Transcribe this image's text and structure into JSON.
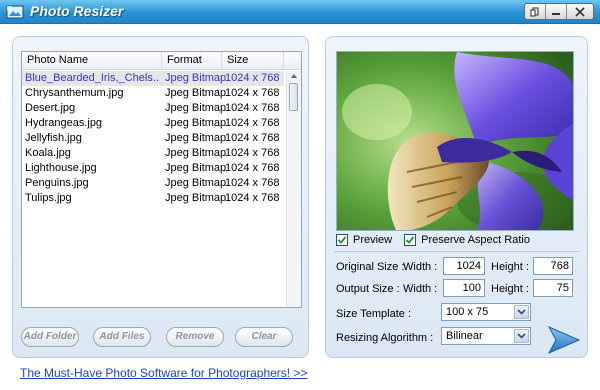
{
  "window": {
    "title": "Photo Resizer",
    "controls": [
      "restore",
      "minimize",
      "close"
    ]
  },
  "file_list": {
    "columns": [
      "Photo Name",
      "Format",
      "Size"
    ],
    "rows": [
      {
        "name": "Blue_Bearded_Iris,_Chels..",
        "format": "Jpeg Bitmap",
        "size": "1024 x 768",
        "selected": true
      },
      {
        "name": "Chrysanthemum.jpg",
        "format": "Jpeg Bitmap",
        "size": "1024 x 768"
      },
      {
        "name": "Desert.jpg",
        "format": "Jpeg Bitmap",
        "size": "1024 x 768"
      },
      {
        "name": "Hydrangeas.jpg",
        "format": "Jpeg Bitmap",
        "size": "1024 x 768"
      },
      {
        "name": "Jellyfish.jpg",
        "format": "Jpeg Bitmap",
        "size": "1024 x 768"
      },
      {
        "name": "Koala.jpg",
        "format": "Jpeg Bitmap",
        "size": "1024 x 768"
      },
      {
        "name": "Lighthouse.jpg",
        "format": "Jpeg Bitmap",
        "size": "1024 x 768"
      },
      {
        "name": "Penguins.jpg",
        "format": "Jpeg Bitmap",
        "size": "1024 x 768"
      },
      {
        "name": "Tulips.jpg",
        "format": "Jpeg Bitmap",
        "size": "1024 x 768"
      }
    ]
  },
  "buttons": {
    "add_folder": "Add Folder",
    "add_files": "Add Files",
    "remove": "Remove",
    "clear": "Clear"
  },
  "preview": {
    "preview_label": "Preview",
    "preview_checked": true,
    "aspect_label": "Preserve Aspect Ratio",
    "aspect_checked": true
  },
  "sizes": {
    "original_label": "Original Size :",
    "output_label": "Output Size :",
    "width_label": "Width :",
    "height_label": "Height :",
    "original_width": "1024",
    "original_height": "768",
    "output_width": "100",
    "output_height": "75"
  },
  "template": {
    "label": "Size Template :",
    "value": "100 x 75"
  },
  "algorithm": {
    "label": "Resizing Algorithm :",
    "value": "Bilinear"
  },
  "promo_link": "The Must-Have Photo Software for Photographers! >>",
  "colors": {
    "titlebar": "#2a93d4",
    "selected_text": "#3333cc",
    "link": "#1a3fcc",
    "accent_arrow": "#2e86d6"
  }
}
